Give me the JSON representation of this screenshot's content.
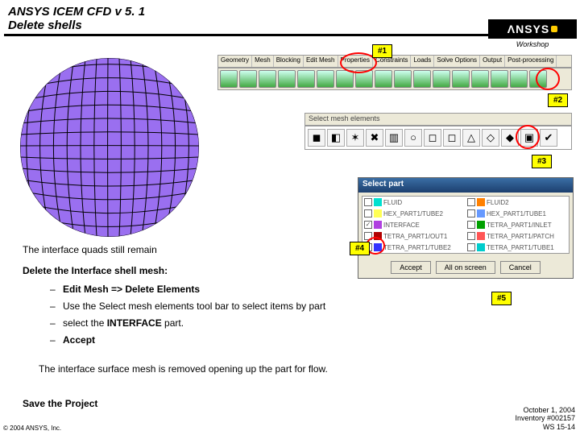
{
  "header": {
    "title1": "ANSYS ICEM CFD v 5. 1",
    "title2": "Delete shells",
    "logo": "ΛNSYS",
    "workshop": "Workshop"
  },
  "callouts": {
    "c1": "#1",
    "c2": "#2",
    "c3": "#3",
    "c4": "#4",
    "c5": "#5"
  },
  "tabs": [
    "Geometry",
    "Mesh",
    "Blocking",
    "Edit Mesh",
    "Properties",
    "Constraints",
    "Loads",
    "Solve Options",
    "Output",
    "Post-processing"
  ],
  "panel2_title": "Select mesh elements",
  "tb2_glyphs": [
    "◼",
    "◧",
    "✶",
    "✖",
    "▥",
    "○",
    "◻",
    "◻",
    "△",
    "◇",
    "◆",
    "▣",
    "✔"
  ],
  "select_part": {
    "title": "Select part",
    "rows": [
      [
        {
          "sw": "#00e0d0",
          "label": "FLUID",
          "checked": false
        },
        {
          "sw": "#ff8000",
          "label": "FLUID2",
          "checked": false
        }
      ],
      [
        {
          "sw": "#ffff55",
          "label": "HEX_PART1/TUBE2",
          "checked": false
        },
        {
          "sw": "#6699ff",
          "label": "HEX_PART1/TUBE1",
          "checked": false
        }
      ],
      [
        {
          "sw": "#b040e0",
          "label": "INTERFACE",
          "checked": true
        },
        {
          "sw": "#00a000",
          "label": "TETRA_PART1/INLET",
          "checked": false
        }
      ],
      [
        {
          "sw": "#b00000",
          "label": "TETRA_PART1/OUT1",
          "checked": false
        },
        {
          "sw": "#ff5555",
          "label": "TETRA_PART1/PATCH",
          "checked": false
        }
      ],
      [
        {
          "sw": "#3333ff",
          "label": "TETRA_PART1/TUBE2",
          "checked": false
        },
        {
          "sw": "#00cccc",
          "label": "TETRA_PART1/TUBE1",
          "checked": false
        }
      ]
    ],
    "buttons": {
      "accept": "Accept",
      "screen": "All on screen",
      "cancel": "Cancel"
    }
  },
  "text": {
    "remain": "The interface quads still remain",
    "delete_heading": "Delete the Interface shell mesh:",
    "b1a": "Edit Mesh => Delete Elements",
    "b2": "Use the Select mesh elements tool bar to select items by part",
    "b3a": "select the ",
    "b3b": "INTERFACE",
    "b3c": " part.",
    "b4": "Accept",
    "after": "The interface surface mesh is removed opening up the part for flow.",
    "save": "Save the Project"
  },
  "footer": {
    "left": "© 2004 ANSYS, Inc.",
    "r1": "October 1, 2004",
    "r2": "Inventory #002157",
    "r3": "WS 15-14"
  }
}
